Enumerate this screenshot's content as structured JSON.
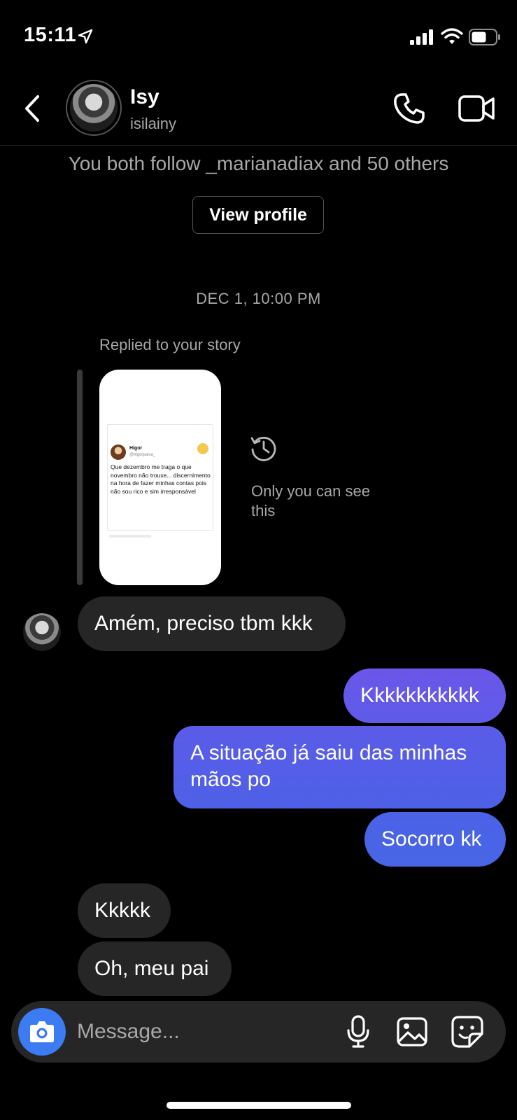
{
  "status_bar": {
    "time": "15:11"
  },
  "header": {
    "name": "Isy",
    "username": "isilainy"
  },
  "profile_banner": {
    "mutual_text": "You both follow _marianadiax and 50 others",
    "view_profile_label": "View profile"
  },
  "date_separator": "DEC 1, 10:00 PM",
  "story_reply": {
    "label": "Replied to your story",
    "privacy_note": "Only you can see this",
    "tweet": {
      "name": "Higor",
      "handle": "@higorpaiva_",
      "text": "Que dezembro me traga o que novembro não trouxe... discernimento na hora de fazer minhas contas pois não sou rico e sim irresponsável"
    }
  },
  "messages": [
    {
      "from": "them",
      "text": "Amém, preciso tbm kkk"
    },
    {
      "from": "me",
      "text": "Kkkkkkkkkkk"
    },
    {
      "from": "me",
      "text": "A situação já saiu das minhas mãos po"
    },
    {
      "from": "me",
      "text": "Socorro kk"
    },
    {
      "from": "them",
      "text": "Kkkkk"
    },
    {
      "from": "them",
      "text": "Oh, meu pai"
    }
  ],
  "composer": {
    "placeholder": "Message..."
  },
  "colors": {
    "outgoing_top": "#6a56e8",
    "outgoing_bottom": "#4766e6",
    "incoming": "#262626",
    "camera": "#3d7bf2"
  }
}
